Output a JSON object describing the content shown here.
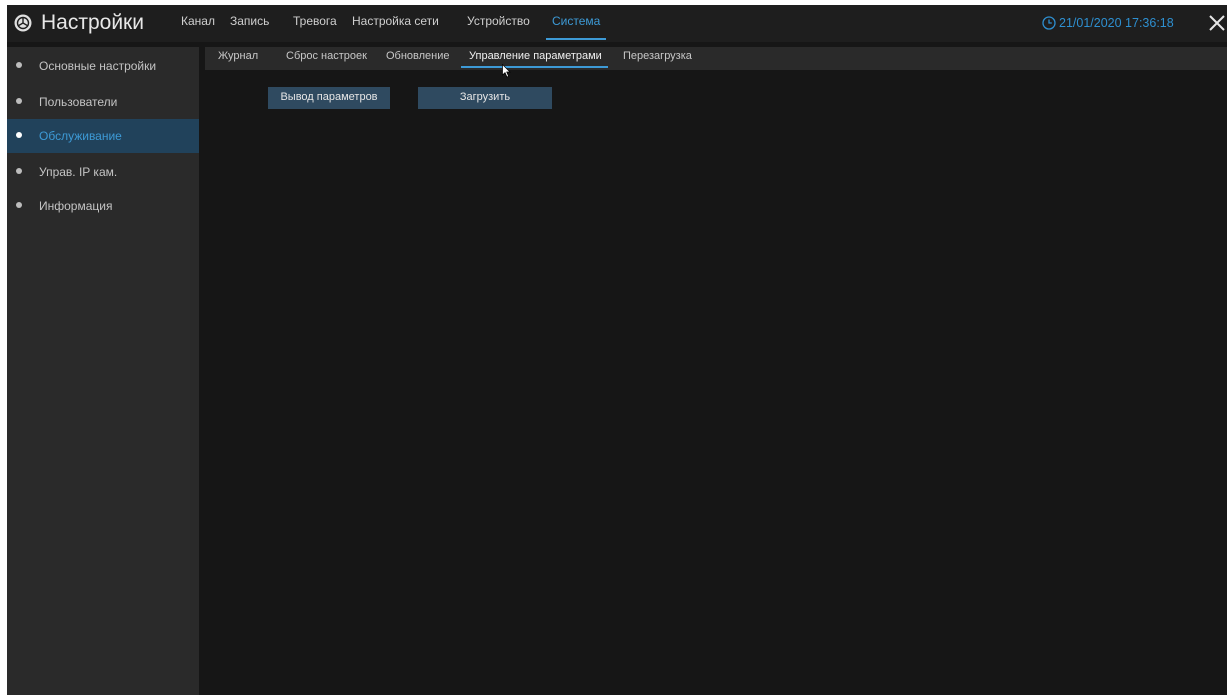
{
  "header": {
    "title": "Настройки",
    "logo_icon": "settings-logo-icon",
    "nav": [
      {
        "label": "Канал"
      },
      {
        "label": "Запись"
      },
      {
        "label": "Тревога"
      },
      {
        "label": "Настройка сети"
      },
      {
        "label": "Устройство"
      },
      {
        "label": "Система",
        "active": true
      }
    ],
    "datetime": "21/01/2020 17:36:18",
    "clock_icon": "clock-icon",
    "close_icon": "close-icon"
  },
  "sidebar": {
    "items": [
      {
        "label": "Основные настройки"
      },
      {
        "label": "Пользователи"
      },
      {
        "label": "Обслуживание",
        "active": true
      },
      {
        "label": "Управ. IP кам."
      },
      {
        "label": "Информация"
      }
    ]
  },
  "subnav": {
    "tabs": [
      {
        "label": "Журнал"
      },
      {
        "label": "Сброс настроек"
      },
      {
        "label": "Обновление"
      },
      {
        "label": "Управление параметрами",
        "active": true
      },
      {
        "label": "Перезагрузка"
      }
    ]
  },
  "main": {
    "export_label": "Вывод параметров",
    "load_label": "Загрузить"
  },
  "colors": {
    "accent": "#3d9ad6",
    "background": "#161616",
    "panel": "#2a2a2a",
    "button": "#2f4a60",
    "sidebar_active": "#21425b"
  }
}
